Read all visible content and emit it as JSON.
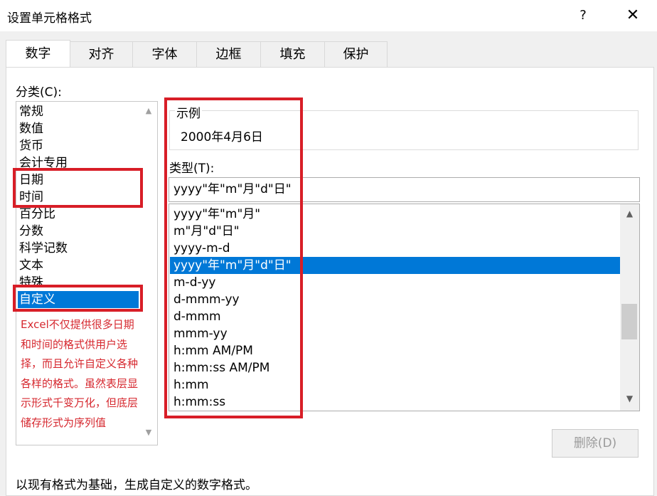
{
  "window": {
    "title": "设置单元格格式",
    "help": "?",
    "close": "✕"
  },
  "tabs": [
    "数字",
    "对齐",
    "字体",
    "边框",
    "填充",
    "保护"
  ],
  "category": {
    "label": "分类(C):",
    "items": [
      "常规",
      "数值",
      "货币",
      "会计专用",
      "日期",
      "时间",
      "百分比",
      "分数",
      "科学记数",
      "文本",
      "特殊",
      "自定义"
    ],
    "selected": "自定义",
    "note": "Excel不仅提供很多日期和时间的格式供用户选择，而且允许自定义各种各样的格式。虽然表层显示形式千变万化，但底层储存形式为序列值"
  },
  "sample": {
    "label": "示例",
    "value": "2000年4月6日"
  },
  "type": {
    "label": "类型(T):",
    "input_value": "yyyy\"年\"m\"月\"d\"日\"",
    "items": [
      "yyyy\"年\"m\"月\"",
      "m\"月\"d\"日\"",
      "yyyy-m-d",
      "yyyy\"年\"m\"月\"d\"日\"",
      "m-d-yy",
      "d-mmm-yy",
      "d-mmm",
      "mmm-yy",
      "h:mm AM/PM",
      "h:mm:ss AM/PM",
      "h:mm",
      "h:mm:ss"
    ],
    "selected": "yyyy\"年\"m\"月\"d\"日\""
  },
  "buttons": {
    "delete": "删除(D)"
  },
  "footer": {
    "description": "以现有格式为基础，生成自定义的数字格式。"
  },
  "icons": {
    "scroll_up": "chevron-up-icon",
    "scroll_down": "chevron-down-icon"
  },
  "colors": {
    "accent": "#0078d7",
    "highlight_box": "#d81e27",
    "note_text": "#d6282f"
  }
}
